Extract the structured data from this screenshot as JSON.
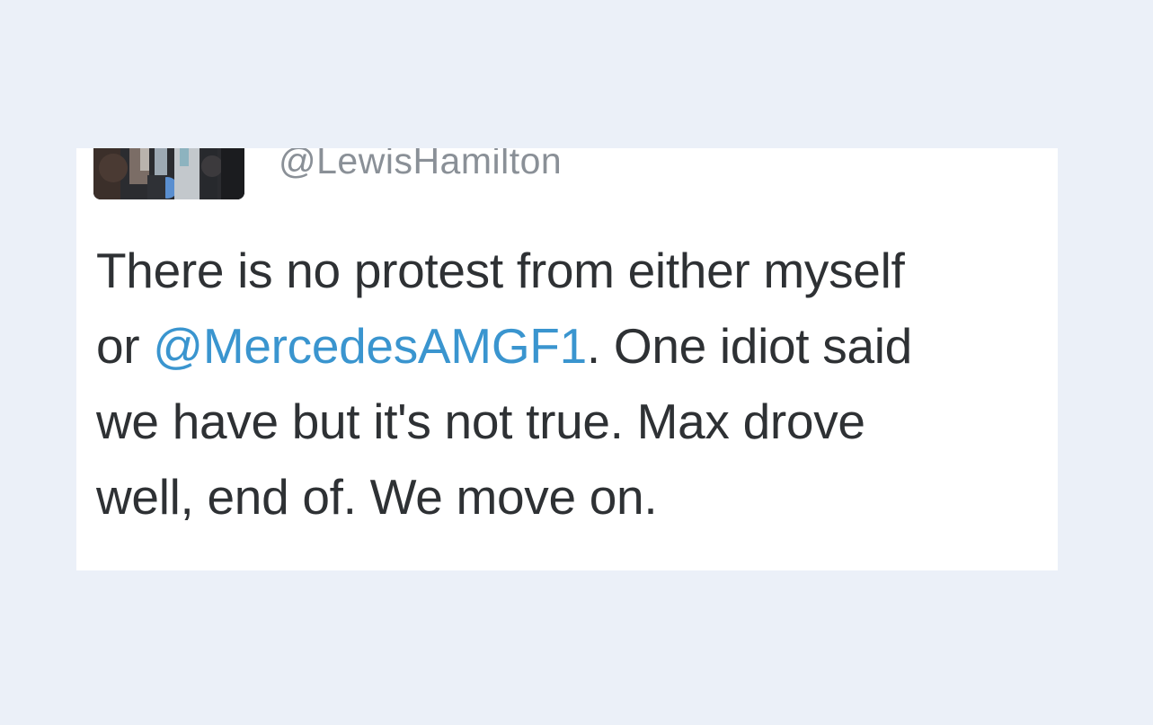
{
  "tweet": {
    "handle": "@LewisHamilton",
    "line1": "There is no protest from either myself",
    "line2_prefix": "or ",
    "mention": "@MercedesAMGF1",
    "line2_suffix": ". One idiot said",
    "line3": "we have but it's not true. Max drove",
    "line4": "well, end of. We move on."
  },
  "colors": {
    "page_background": "#ebf0f8",
    "card_background": "#ffffff",
    "text": "#2e3134",
    "handle": "#8a9097",
    "mention_link": "#3a95cf"
  },
  "icons": {
    "avatar": "profile-photo"
  }
}
